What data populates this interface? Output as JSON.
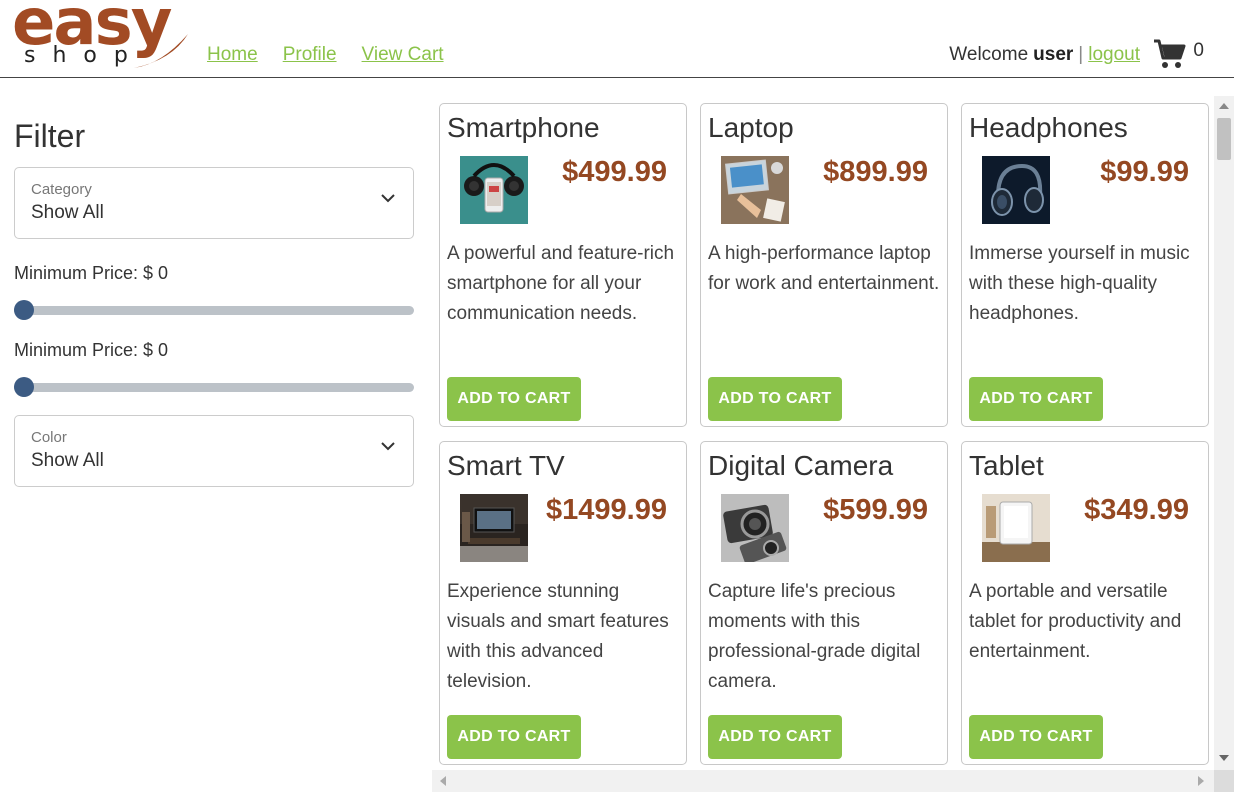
{
  "logo": {
    "word": "easy",
    "subword": "shop"
  },
  "nav": {
    "home": "Home",
    "profile": "Profile",
    "cart": "View Cart"
  },
  "user": {
    "welcome": "Welcome",
    "name": "user",
    "separator": "|",
    "logout": "logout"
  },
  "cart": {
    "count": "0",
    "icon": "shopping-cart-icon"
  },
  "sidebar": {
    "title": "Filter",
    "category": {
      "label": "Category",
      "value": "Show All"
    },
    "min_price_1": {
      "label": "Minimum Price: $ 0",
      "value": 0
    },
    "min_price_2": {
      "label": "Minimum Price: $ 0",
      "value": 0
    },
    "color": {
      "label": "Color",
      "value": "Show All"
    }
  },
  "products": [
    {
      "name": "Smartphone",
      "price": "$499.99",
      "desc": "A powerful and feature-rich smartphone for all your communication needs.",
      "button": "ADD TO CART"
    },
    {
      "name": "Laptop",
      "price": "$899.99",
      "desc": "A high-performance laptop for work and entertainment.",
      "button": "ADD TO CART"
    },
    {
      "name": "Headphones",
      "price": "$99.99",
      "desc": "Immerse yourself in music with these high-quality headphones.",
      "button": "ADD TO CART"
    },
    {
      "name": "Smart TV",
      "price": "$1499.99",
      "desc": "Experience stunning visuals and smart features with this advanced television.",
      "button": "ADD TO CART"
    },
    {
      "name": "Digital Camera",
      "price": "$599.99",
      "desc": "Capture life's precious moments with this professional-grade digital camera.",
      "button": "ADD TO CART"
    },
    {
      "name": "Tablet",
      "price": "$349.99",
      "desc": "A portable and versatile tablet for productivity and entertainment.",
      "button": "ADD TO CART"
    }
  ],
  "colors": {
    "brand": "#a24b24",
    "accent": "#8bc34a",
    "price": "#944822",
    "slider_thumb": "#3c5b83"
  }
}
